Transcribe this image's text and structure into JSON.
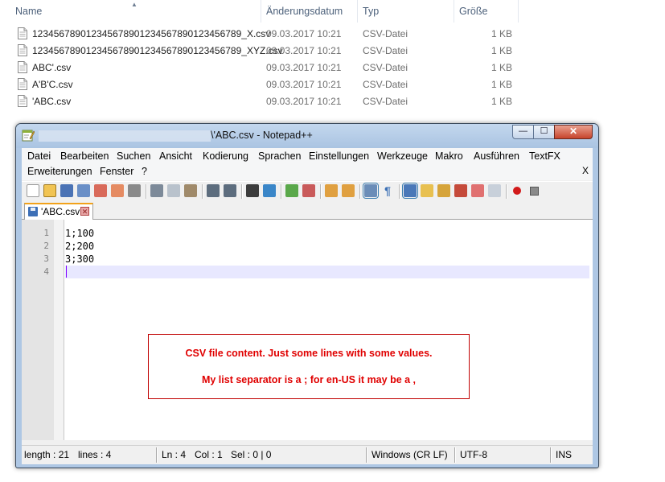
{
  "explorer": {
    "columns": [
      "Name",
      "Änderungsdatum",
      "Typ",
      "Größe"
    ],
    "files": [
      {
        "name": "123456789012345678901234567890123456789_X.csv",
        "date": "09.03.2017 10:21",
        "type": "CSV-Datei",
        "size": "1 KB"
      },
      {
        "name": "123456789012345678901234567890123456789_XYZ.csv",
        "date": "09.03.2017 10:21",
        "type": "CSV-Datei",
        "size": "1 KB"
      },
      {
        "name": "ABC'.csv",
        "date": "09.03.2017 10:21",
        "type": "CSV-Datei",
        "size": "1 KB"
      },
      {
        "name": "A'B'C.csv",
        "date": "09.03.2017 10:21",
        "type": "CSV-Datei",
        "size": "1 KB"
      },
      {
        "name": "'ABC.csv",
        "date": "09.03.2017 10:21",
        "type": "CSV-Datei",
        "size": "1 KB"
      }
    ]
  },
  "notepad": {
    "title": "\\'ABC.csv - Notepad++",
    "window_buttons": {
      "minimize": "—",
      "maximize": "☐",
      "close": "✕"
    },
    "menu": [
      "Datei",
      "Bearbeiten",
      "Suchen",
      "Ansicht",
      "Kodierung",
      "Sprachen",
      "Einstellungen",
      "Werkzeuge",
      "Makro",
      "Ausführen",
      "TextFX",
      "Erweiterungen",
      "Fenster",
      "?"
    ],
    "menu_close": "X",
    "tab": {
      "label": "'ABC.csv",
      "close": "✕"
    },
    "lines": [
      {
        "number": "1",
        "text": "1;100"
      },
      {
        "number": "2",
        "text": "2;200"
      },
      {
        "number": "3",
        "text": "3;300"
      },
      {
        "number": "4",
        "text": ""
      }
    ],
    "annotation": {
      "line1": "CSV file content. Just some lines with some values.",
      "line2": "My list separator is a ; for en-US it may be a ,"
    },
    "status": {
      "length": "length : 21",
      "lines": "lines : 4",
      "ln": "Ln : 4",
      "col": "Col : 1",
      "sel": "Sel : 0 | 0",
      "eol": "Windows (CR LF)",
      "encoding": "UTF-8",
      "mode": "INS"
    }
  },
  "colors": {
    "accent": "#f2a21b",
    "annotation_red": "#e00000",
    "current_line": "#e8e8ff",
    "caret": "#8000ff"
  }
}
